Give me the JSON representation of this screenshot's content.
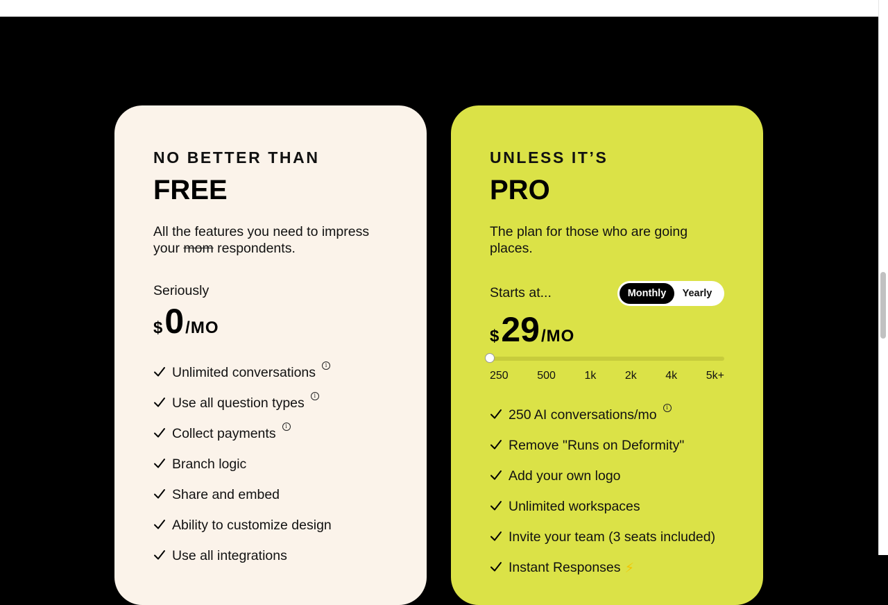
{
  "free": {
    "eyebrow": "NO BETTER THAN",
    "name": "FREE",
    "description_before": "All the features you need to impress your ",
    "description_struck": "mom",
    "description_after": " respondents.",
    "price_label": "Seriously",
    "currency": "$",
    "amount": "0",
    "period": "/MO",
    "features": [
      {
        "label": "Unlimited conversations",
        "info": true
      },
      {
        "label": "Use all question types",
        "info": true
      },
      {
        "label": "Collect payments",
        "info": true
      },
      {
        "label": "Branch logic",
        "info": false
      },
      {
        "label": "Share and embed",
        "info": false
      },
      {
        "label": "Ability to customize design",
        "info": false
      },
      {
        "label": "Use all integrations",
        "info": false
      }
    ]
  },
  "pro": {
    "eyebrow": "UNLESS IT’S",
    "name": "PRO",
    "description": "The plan for those who are going places.",
    "price_label": "Starts at...",
    "billing": {
      "options": [
        "Monthly",
        "Yearly"
      ],
      "selected": "Monthly"
    },
    "currency": "$",
    "amount": "29",
    "period": "/MO",
    "slider": {
      "ticks": [
        "250",
        "500",
        "1k",
        "2k",
        "4k",
        "5k+"
      ],
      "selected": "250",
      "fraction": 0
    },
    "features": [
      {
        "label": "250 AI conversations/mo",
        "info": true
      },
      {
        "label": "Remove \"Runs on Deformity\"",
        "info": false
      },
      {
        "label": "Add your own logo",
        "info": false
      },
      {
        "label": "Unlimited workspaces",
        "info": false
      },
      {
        "label": "Invite your team (3 seats included)",
        "info": false
      },
      {
        "label": "Instant Responses",
        "info": false,
        "bolt": "⚡"
      }
    ]
  },
  "icons": {
    "check": "check-icon",
    "info": "info-icon",
    "info_glyph": "i"
  },
  "colors": {
    "page_background": "#000000",
    "free_card": "#fbf3ea",
    "pro_card": "#dbe247",
    "toggle_active": "#000000"
  }
}
